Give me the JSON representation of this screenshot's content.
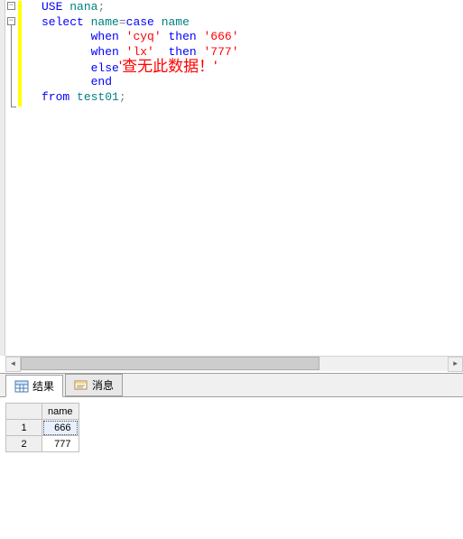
{
  "code": {
    "lines": [
      {
        "html": "<span class='kw'>USE</span> <span class='obj'>nana</span><span class='op'>;</span>"
      },
      {
        "html": "<span class='kw'>select</span> <span class='obj'>name</span><span class='op'>=</span><span class='kw'>case</span> <span class='obj'>name</span>"
      },
      {
        "html": "       <span class='kw'>when</span> <span class='str'>'cyq'</span> <span class='kw'>then</span> <span class='str'>'666'</span>"
      },
      {
        "html": "       <span class='kw'>when</span> <span class='str'>'lx'</span>  <span class='kw'>then</span> <span class='str'>'777'</span>"
      },
      {
        "html": "       <span class='kw'>else</span><span class='big'>'查无此数据！'</span>"
      },
      {
        "html": "       <span class='kw'>end</span>"
      },
      {
        "html": "<span class='kw'>from</span> <span class='obj'>test01</span><span class='op'>;</span>"
      }
    ]
  },
  "tabs": {
    "results": "结果",
    "messages": "消息"
  },
  "grid": {
    "columns": [
      "name"
    ],
    "rows": [
      {
        "num": "1",
        "cells": [
          "666"
        ],
        "selected": true
      },
      {
        "num": "2",
        "cells": [
          "777"
        ],
        "selected": false
      }
    ]
  }
}
